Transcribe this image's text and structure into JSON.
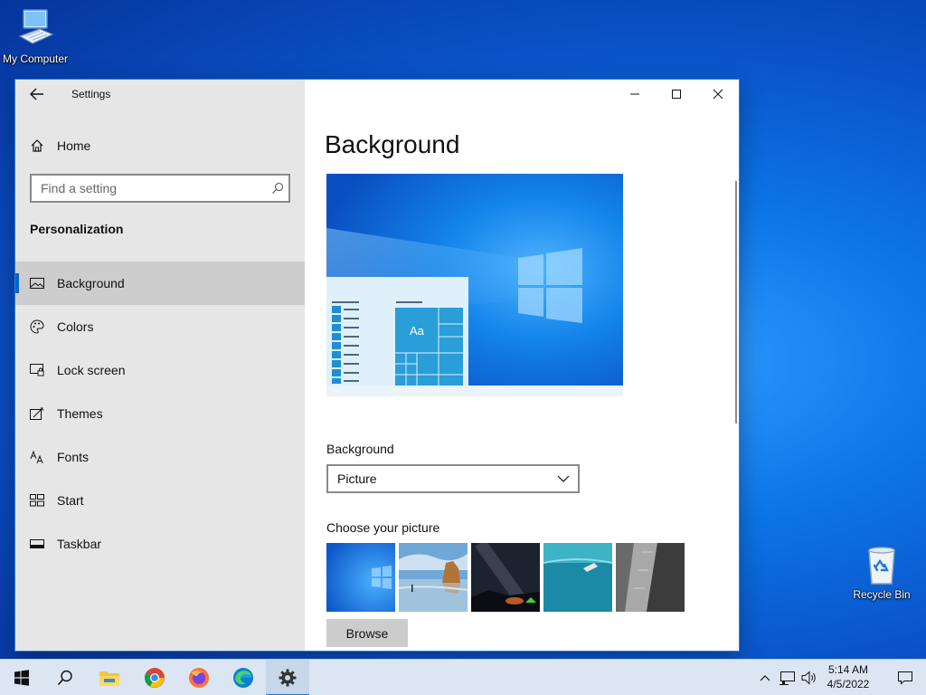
{
  "desktop": {
    "icons": [
      {
        "label": "My Computer"
      },
      {
        "label": "Recycle Bin"
      }
    ]
  },
  "window": {
    "app_title": "Settings",
    "sidebar": {
      "home_label": "Home",
      "search_placeholder": "Find a setting",
      "section_title": "Personalization",
      "items": [
        {
          "label": "Background",
          "icon": "picture-icon",
          "active": true
        },
        {
          "label": "Colors",
          "icon": "palette-icon"
        },
        {
          "label": "Lock screen",
          "icon": "lock-screen-icon"
        },
        {
          "label": "Themes",
          "icon": "themes-icon"
        },
        {
          "label": "Fonts",
          "icon": "fonts-icon"
        },
        {
          "label": "Start",
          "icon": "start-icon"
        },
        {
          "label": "Taskbar",
          "icon": "taskbar-icon"
        }
      ]
    },
    "content": {
      "page_title": "Background",
      "preview_tile_text": "Aa",
      "background_label": "Background",
      "background_value": "Picture",
      "choose_picture_label": "Choose your picture",
      "pictures": [
        "windows-blue",
        "beach-rocks",
        "night-sky",
        "underwater-swimmer",
        "rock-cliff"
      ],
      "browse_label": "Browse"
    }
  },
  "taskbar": {
    "apps": [
      "start",
      "search",
      "file-explorer",
      "chrome",
      "firefox",
      "edge",
      "settings"
    ],
    "active_app": "settings",
    "clock": {
      "time": "5:14 AM",
      "date": "4/5/2022"
    }
  },
  "colors": {
    "accent": "#0067c0",
    "sidebar_bg": "#e6e6e6",
    "taskbar_bg": "#dce6f2"
  }
}
